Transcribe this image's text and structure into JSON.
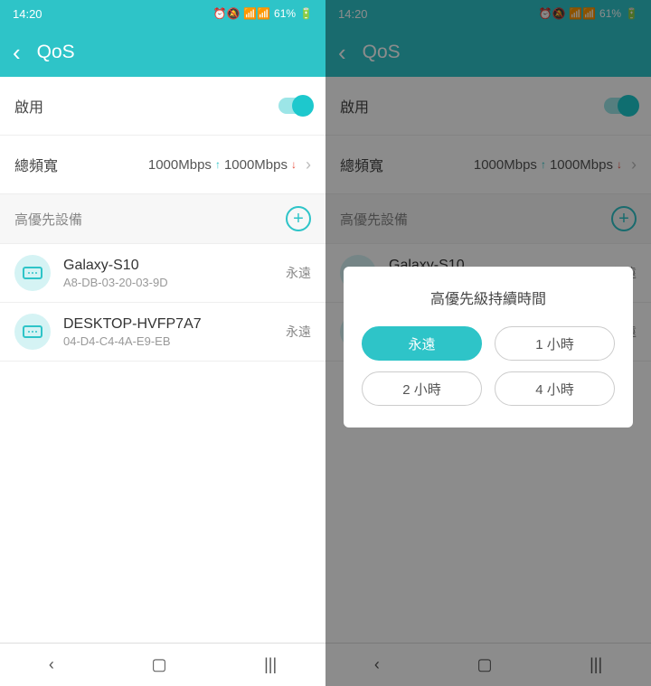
{
  "statusbar": {
    "time": "14:20",
    "battery_text": "61%"
  },
  "header": {
    "title": "QoS"
  },
  "enable": {
    "label": "啟用",
    "on": true
  },
  "bandwidth": {
    "label": "總頻寬",
    "up": "1000Mbps",
    "down": "1000Mbps"
  },
  "section": {
    "title": "高優先設備"
  },
  "devices": [
    {
      "name": "Galaxy-S10",
      "mac": "A8-DB-03-20-03-9D",
      "duration": "永遠"
    },
    {
      "name": "DESKTOP-HVFP7A7",
      "mac": "04-D4-C4-4A-E9-EB",
      "duration": "永遠"
    }
  ],
  "modal": {
    "title": "高優先級持續時間",
    "options": [
      "永遠",
      "1 小時",
      "2 小時",
      "4 小時"
    ],
    "selected": 0
  }
}
